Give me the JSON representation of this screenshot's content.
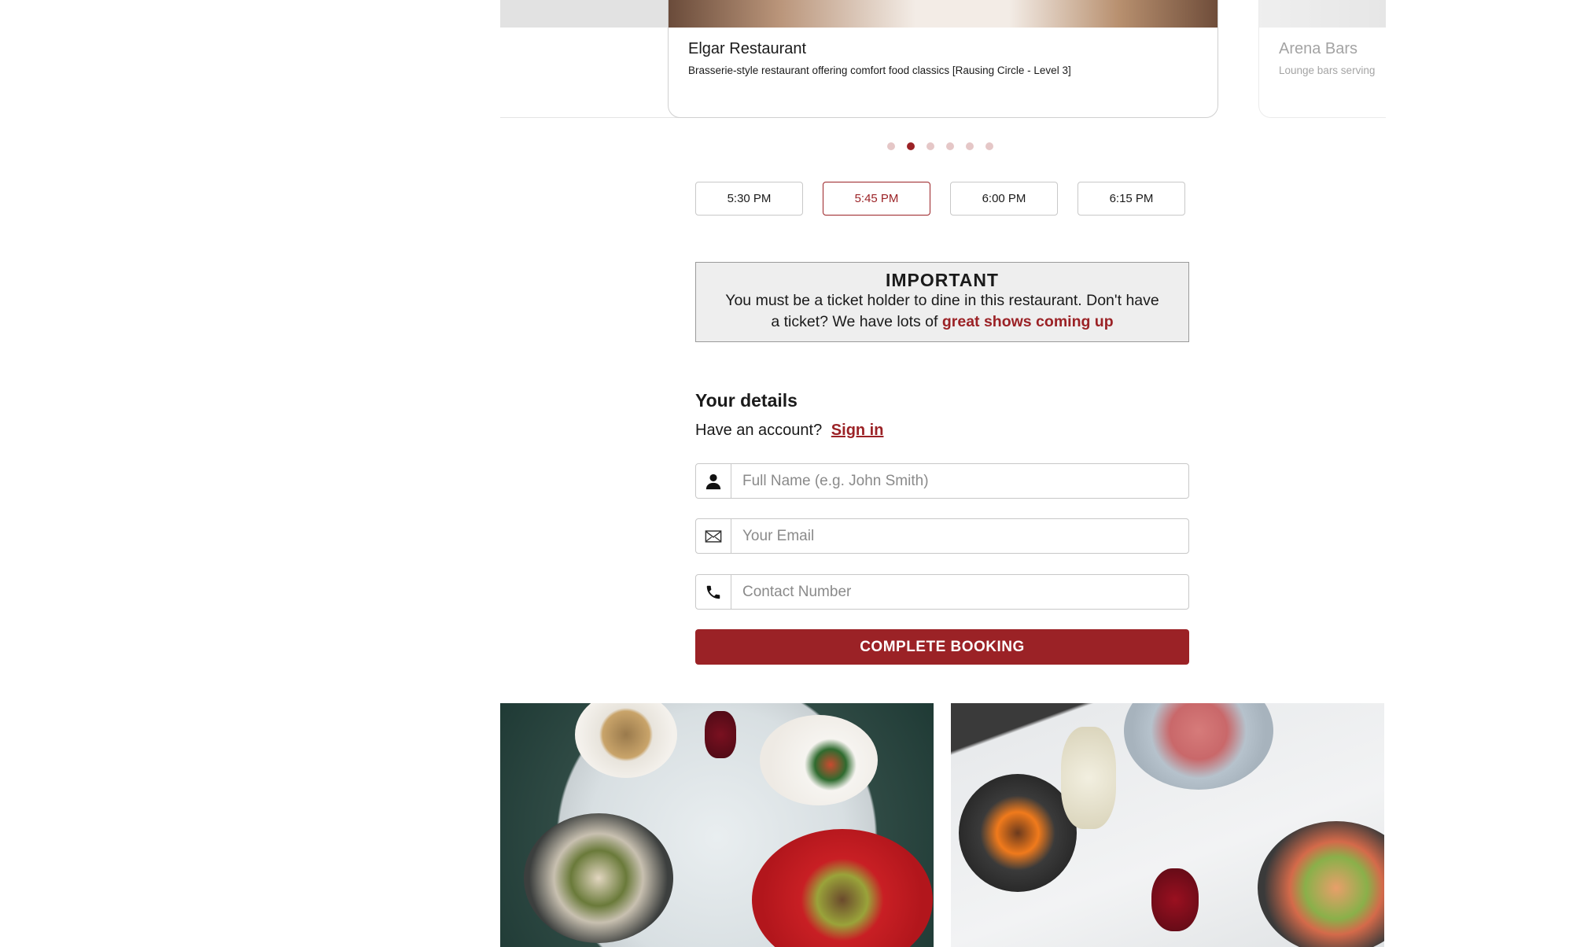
{
  "carousel": {
    "cards": [
      {
        "title": "",
        "description": ""
      },
      {
        "title": "Elgar Restaurant",
        "description": "Brasserie-style restaurant offering comfort food classics [Rausing Circle - Level 3]"
      },
      {
        "title": "Arena Bars",
        "description": "Lounge bars serving"
      }
    ],
    "active_index": 1,
    "dot_count": 6
  },
  "times": [
    "5:30 PM",
    "5:45 PM",
    "6:00 PM",
    "6:15 PM"
  ],
  "selected_time": "5:45 PM",
  "notice": {
    "title": "IMPORTANT",
    "text": "You must be a ticket holder to dine in this restaurant. Don't have a ticket? We have lots of ",
    "link": "great shows coming up"
  },
  "details": {
    "title": "Your details",
    "account_prompt": "Have an account?",
    "sign_in": "Sign in"
  },
  "form": {
    "name_placeholder": "Full Name (e.g. John Smith)",
    "email_placeholder": "Your Email",
    "phone_placeholder": "Contact Number",
    "submit": "COMPLETE BOOKING"
  },
  "icons": {
    "name": "person-icon",
    "email": "envelope-icon",
    "phone": "phone-icon"
  },
  "colors": {
    "accent": "#9b2226",
    "dot_inactive": "#e5c7c7"
  }
}
